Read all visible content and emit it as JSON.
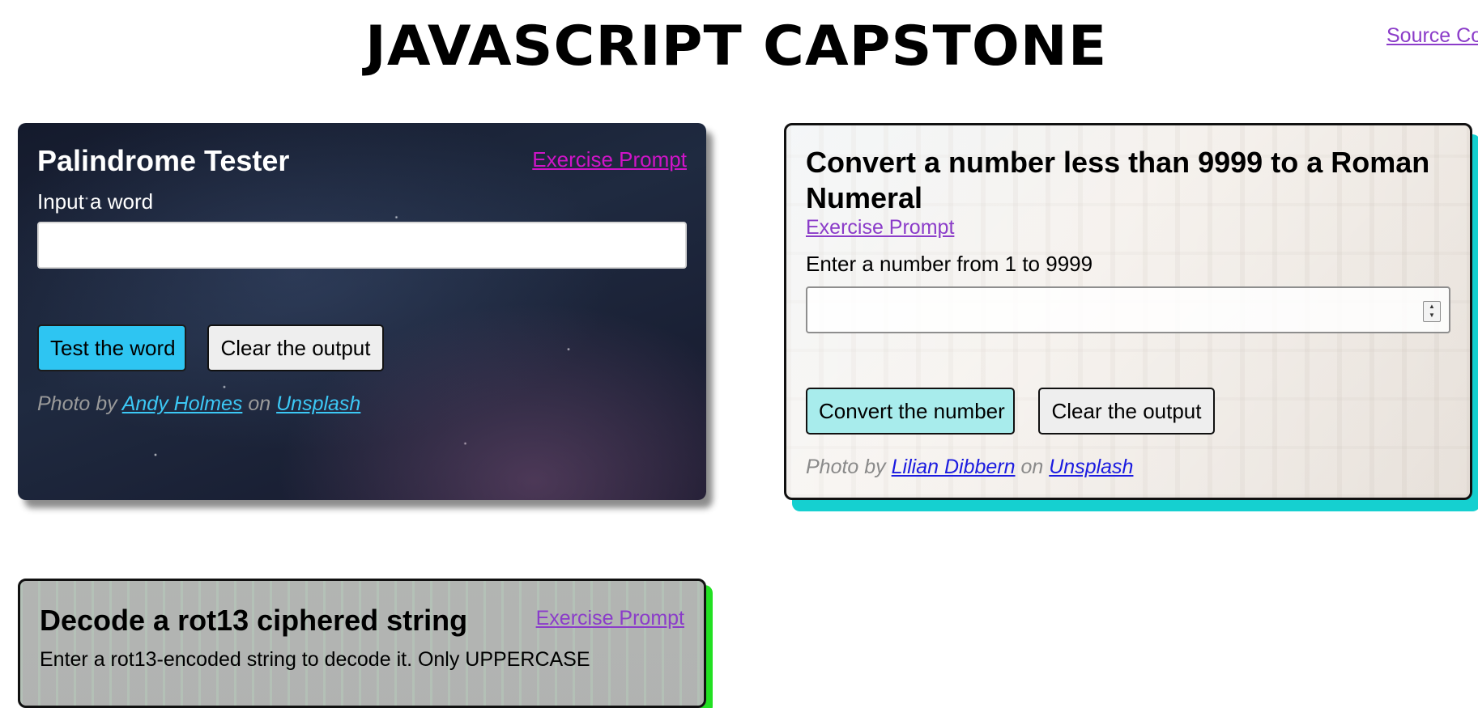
{
  "header": {
    "title": "JAVASCRIPT CAPSTONE",
    "source_link": "Source Co"
  },
  "palindrome": {
    "title": "Palindrome Tester",
    "prompt_link": "Exercise Prompt",
    "input_label": "Input a word",
    "input_value": "",
    "test_button": "Test the word",
    "clear_button": "Clear the output",
    "credit_prefix": "Photo by",
    "credit_author": "Andy Holmes",
    "credit_on": "on",
    "credit_site": "Unsplash"
  },
  "roman": {
    "title": "Convert a number less than 9999 to a Roman Numeral",
    "prompt_link": "Exercise Prompt",
    "input_label": "Enter a number from 1 to 9999",
    "input_value": "",
    "convert_button": "Convert the number",
    "clear_button": "Clear the output",
    "credit_prefix": "Photo by",
    "credit_author": "Lilian Dibbern",
    "credit_on": "on",
    "credit_site": "Unsplash"
  },
  "rot13": {
    "title": "Decode a rot13 ciphered string",
    "prompt_link": "Exercise Prompt",
    "input_label": "Enter a rot13-encoded string to decode it. Only UPPERCASE"
  },
  "colors": {
    "palindrome_test_button": "#2ec5f2",
    "roman_convert_button": "#a8ecec",
    "roman_card_shadow": "#15d0d0",
    "rot13_card_shadow": "#22e022",
    "prompt_link_palindrome": "#d014c8",
    "prompt_link": "#8b3cc9"
  }
}
